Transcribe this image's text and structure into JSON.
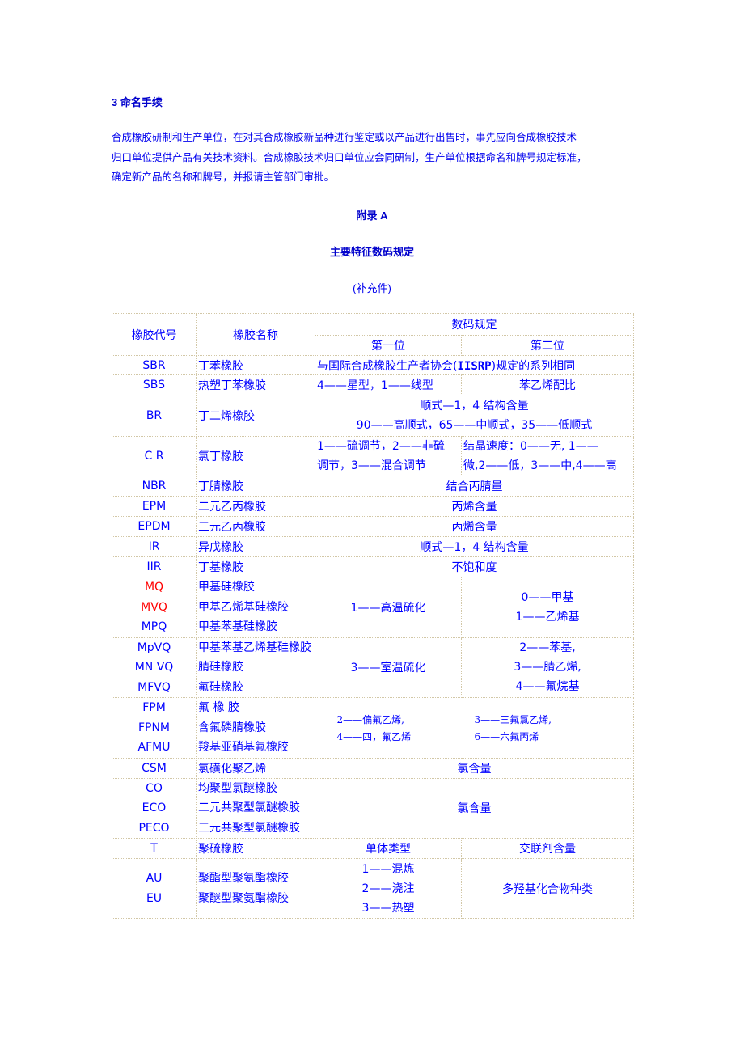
{
  "section": {
    "heading": "3 命名手续",
    "paragraph_lines": [
      "合成橡胶研制和生产单位，在对其合成橡胶新品种进行鉴定或以产品进行出售时，事先应向合成橡胶技术",
      "归口单位提供产品有关技术资料。合成橡胶技术归口单位应会同研制，生产单位根据命名和牌号规定标准，",
      "确定新产品的名称和牌号，并报请主管部门审批。"
    ]
  },
  "appendix": {
    "label": "附录 A",
    "title": "主要特征数码规定",
    "note": "(补充件)"
  },
  "table": {
    "headers": {
      "code": "橡胶代号",
      "name": "橡胶名称",
      "digit_rule": "数码规定",
      "first_digit": "第一位",
      "second_digit": "第二位"
    },
    "rows": {
      "sbr": {
        "code": "SBR",
        "name": "丁苯橡胶",
        "value_prefix": "与国际合成橡胶生产者协会(",
        "value_bold": "IISRP",
        "value_suffix": ")规定的系列相同"
      },
      "sbs": {
        "code": "SBS",
        "name": "热塑丁苯橡胶",
        "first": "4——星型，1——线型",
        "second": "苯乙烯配比"
      },
      "br": {
        "code": "BR",
        "name": "丁二烯橡胶",
        "value_lines": [
          "顺式—1，4 结构含量",
          "90——高顺式，65——中顺式，35——低顺式"
        ]
      },
      "cr": {
        "code": "C R",
        "name": "氯丁橡胶",
        "first_lines": [
          "1——硫调节，2——非硫",
          "调节，3——混合调节"
        ],
        "second_lines": [
          "结晶速度：0——无, 1——",
          "微,2——低，3——中,4——高"
        ]
      },
      "nbr": {
        "code": "NBR",
        "name": "丁腈橡胶",
        "value": "结合丙腈量"
      },
      "epm": {
        "code": "EPM",
        "name": "二元乙丙橡胶",
        "value": "丙烯含量"
      },
      "epdm": {
        "code": "EPDM",
        "name": "三元乙丙橡胶",
        "value": "丙烯含量"
      },
      "ir": {
        "code": "IR",
        "name": "异戊橡胶",
        "value": "顺式—1，4 结构含量"
      },
      "iir": {
        "code": "IIR",
        "name": "丁基橡胶",
        "value": "不饱和度"
      },
      "silicone_hot": {
        "codes": [
          "MQ",
          "MVQ",
          "MPQ"
        ],
        "names": [
          "甲基硅橡胶",
          "甲基乙烯基硅橡胶",
          "甲基苯基硅橡胶"
        ],
        "first": "1——高温硫化",
        "second_lines": [
          "0——甲基",
          "1——乙烯基"
        ]
      },
      "silicone_rt": {
        "codes": [
          "MpVQ",
          "MN VQ",
          "MFVQ"
        ],
        "names": [
          "甲基苯基乙烯基硅橡胶",
          "腈硅橡胶",
          "氟硅橡胶"
        ],
        "first": "3——室温硫化",
        "second_lines": [
          "2——苯基,",
          "3——腈乙烯,",
          "4——氟烷基"
        ]
      },
      "fluoro": {
        "codes": [
          "FPM",
          "FPNM",
          "AFMU"
        ],
        "names": [
          "氟 橡 胶",
          "含氟磷腈橡胶",
          "羧基亚硝基氟橡胶"
        ],
        "value_items": [
          "2——偏氟乙烯,",
          "3——三氟氯乙烯,",
          "4——四，氟乙烯",
          "6——六氟丙烯"
        ]
      },
      "csm": {
        "code": "CSM",
        "name": "氯磺化聚乙烯",
        "value": "氯含量"
      },
      "epichloro": {
        "codes": [
          "CO",
          "ECO",
          "PECO"
        ],
        "names": [
          "均聚型氯醚橡胶",
          "二元共聚型氯醚橡胶",
          "三元共聚型氯醚橡胶"
        ],
        "value": "氯含量"
      },
      "t": {
        "code": "T",
        "name": "聚硫橡胶",
        "first": "单体类型",
        "second": "交联剂含量"
      },
      "urethane": {
        "codes": [
          "AU",
          "EU"
        ],
        "names": [
          "聚酯型聚氨酯橡胶",
          "聚醚型聚氨酯橡胶"
        ],
        "first_lines": [
          "1——混炼",
          "2——浇注",
          "3——热塑"
        ],
        "second": "多羟基化合物种类"
      }
    }
  },
  "colors": {
    "text": "#0000ff",
    "highlight_red": "#ff0000",
    "border": "#d2c7a6"
  }
}
